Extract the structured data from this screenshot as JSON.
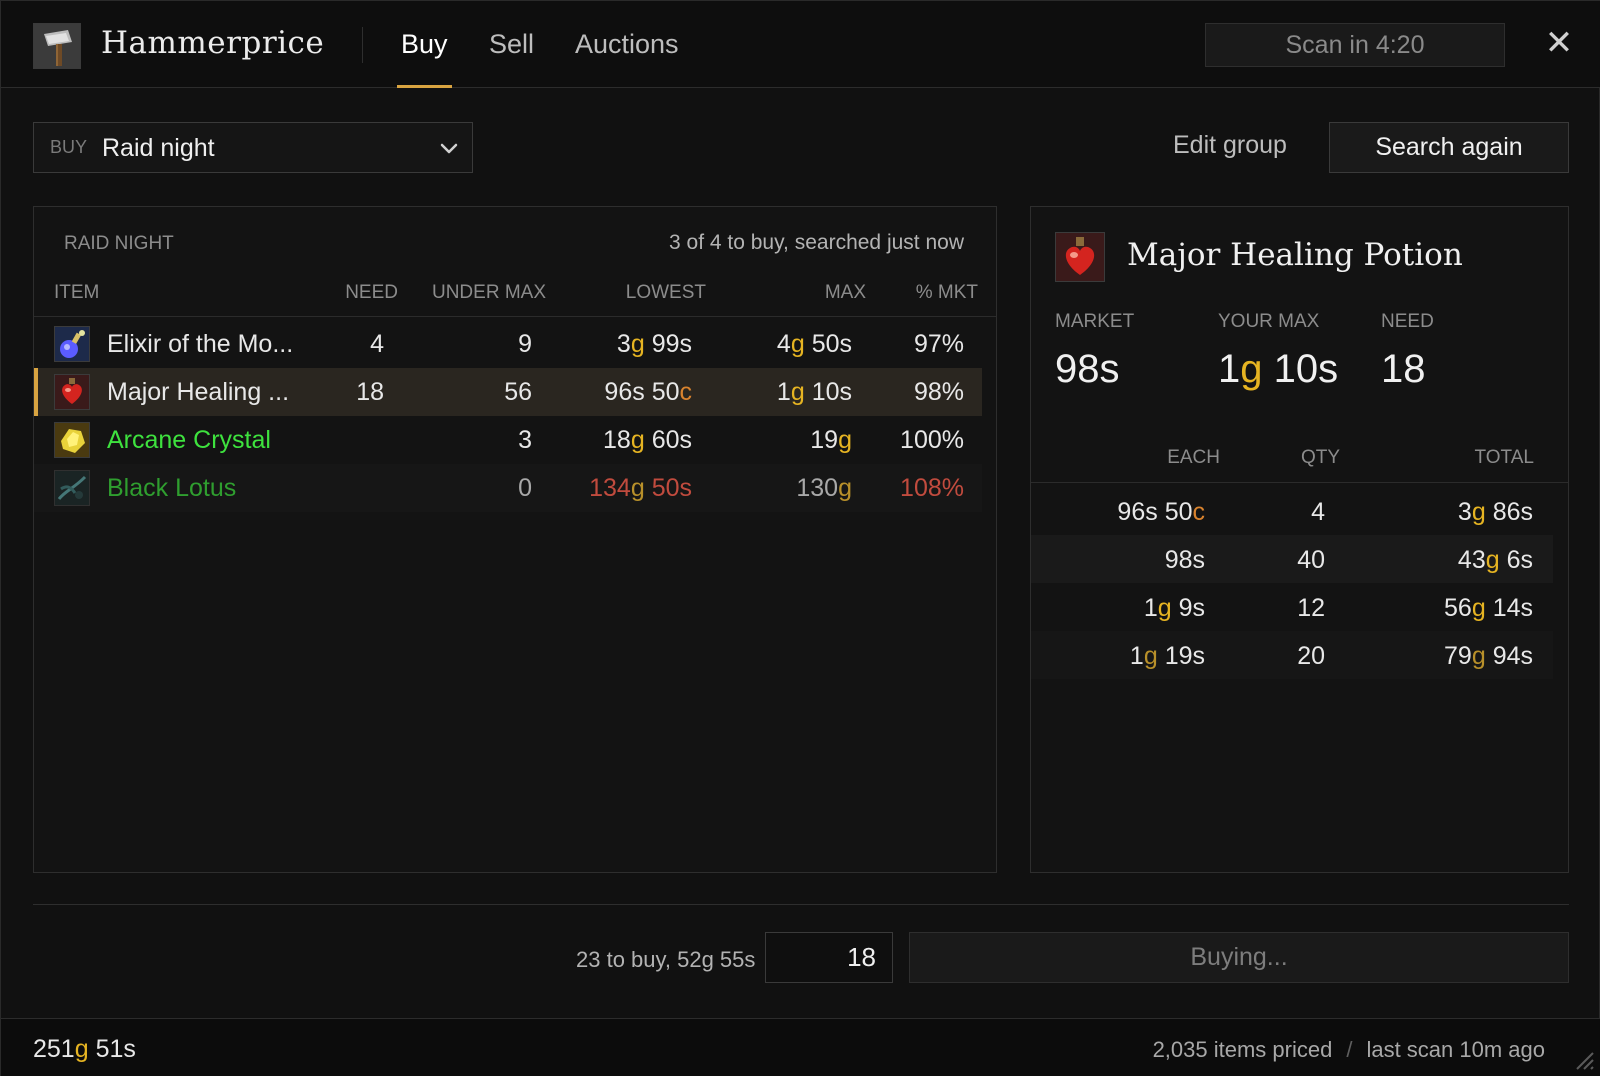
{
  "app": {
    "title": "Hammerprice",
    "icon": "hammer-icon"
  },
  "tabs": [
    {
      "label": "Buy",
      "active": true
    },
    {
      "label": "Sell",
      "active": false
    },
    {
      "label": "Auctions",
      "active": false
    }
  ],
  "scan_timer": "Scan in 4:20",
  "toolbar": {
    "buy_tag": "BUY",
    "group_selected": "Raid night",
    "edit_group_label": "Edit group",
    "search_again_label": "Search again"
  },
  "list": {
    "title": "RAID NIGHT",
    "status": "3 of 4 to buy, searched just now",
    "columns": {
      "item": "ITEM",
      "need": "NEED",
      "under_max": "UNDER MAX",
      "lowest": "LOWEST",
      "max": "MAX",
      "pct_mkt": "% MKT"
    },
    "rows": [
      {
        "icon": "elixir-icon",
        "name": "Elixir of the Mo...",
        "need": "4",
        "under_max": "9",
        "lowest": {
          "g": "3",
          "s": "99"
        },
        "max": {
          "g": "4",
          "s": "50"
        },
        "pct": "97%"
      },
      {
        "icon": "healing-potion-icon",
        "name": "Major Healing ...",
        "need": "18",
        "under_max": "56",
        "lowest": {
          "s": "96",
          "c": "50"
        },
        "max": {
          "g": "1",
          "s": "10"
        },
        "pct": "98%",
        "selected": true
      },
      {
        "icon": "arcane-crystal-icon",
        "name": "Arcane Crystal",
        "need": "",
        "under_max": "3",
        "lowest": {
          "g": "18",
          "s": "60"
        },
        "max": {
          "g": "19"
        },
        "pct": "100%"
      },
      {
        "icon": "black-lotus-icon",
        "name": "Black Lotus",
        "need": "",
        "under_max": "0",
        "lowest": {
          "g": "134",
          "s": "50"
        },
        "max": {
          "g": "130"
        },
        "pct": "108%"
      }
    ]
  },
  "detail": {
    "icon": "healing-potion-icon",
    "title": "Major Healing Potion",
    "market_label": "MARKET",
    "market": {
      "s": "98"
    },
    "your_max_label": "YOUR MAX",
    "your_max": {
      "g": "1",
      "s": "10"
    },
    "need_label": "NEED",
    "need": "18",
    "columns": {
      "each": "EACH",
      "qty": "QTY",
      "total": "TOTAL"
    },
    "tiers": [
      {
        "each": {
          "s": "96",
          "c": "50"
        },
        "qty": "4",
        "total": {
          "g": "3",
          "s": "86"
        }
      },
      {
        "each": {
          "s": "98"
        },
        "qty": "40",
        "total": {
          "g": "43",
          "s": "6"
        }
      },
      {
        "each": {
          "g": "1",
          "s": "9"
        },
        "qty": "12",
        "total": {
          "g": "56",
          "s": "14"
        }
      },
      {
        "each": {
          "g": "1",
          "s": "19"
        },
        "qty": "20",
        "total": {
          "g": "79",
          "s": "94"
        }
      }
    ]
  },
  "footer": {
    "summary": "23 to buy, 52g 55s",
    "quantity_value": "18",
    "buy_button_label": "Buying..."
  },
  "statusbar": {
    "gold": {
      "g": "251",
      "s": "51"
    },
    "items_priced": "2,035 items priced",
    "separator": "/",
    "last_scan": "last scan 10m ago"
  },
  "colors": {
    "accent": "#d9a441",
    "gold_unit": "#e6b422",
    "copper_unit": "#d9832e",
    "over_max": "#c14b3e",
    "uncommon": "#3ee23e"
  }
}
